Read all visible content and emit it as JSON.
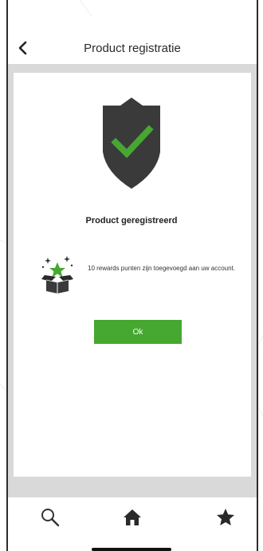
{
  "header": {
    "title": "Product registratie",
    "back_icon": "chevron-left-icon"
  },
  "main": {
    "status_icon": "shield-check-icon",
    "status_text": "Product geregistreerd",
    "reward_icon": "gift-box-star-icon",
    "reward_text": "10 rewards punten zijn toegevoegd aan uw account.",
    "ok_label": "Ok"
  },
  "tabbar": {
    "items": [
      {
        "icon": "search-icon"
      },
      {
        "icon": "home-icon"
      },
      {
        "icon": "star-icon"
      }
    ]
  },
  "colors": {
    "accent_green": "#46a830",
    "shield_dark": "#3a3a3a",
    "gray_band": "#d9d9d9"
  }
}
